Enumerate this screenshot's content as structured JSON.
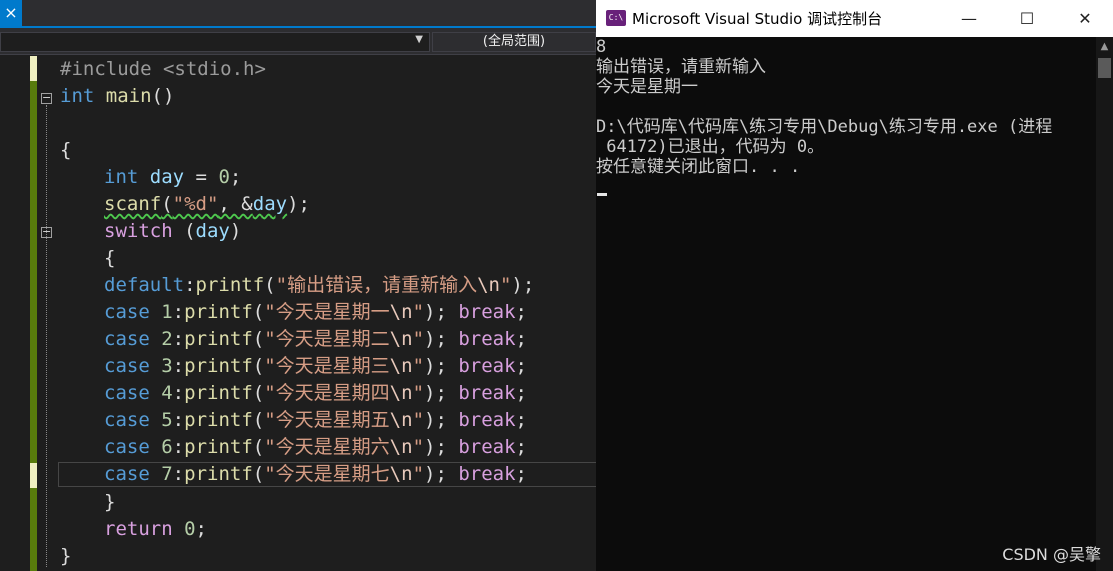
{
  "editor": {
    "tab_close_glyph": "×",
    "nav_scope": "(全局范围)",
    "code": {
      "l1_pp": "#include <stdio.h>",
      "l2_kw": "int",
      "l2_fn": "main",
      "l2_rest": "()",
      "l4": "{",
      "l5_kw": "int",
      "l5_var": "day",
      "l5_op": " = ",
      "l5_num": "0",
      "l5_end": ";",
      "l6_fn": "scanf",
      "l6_open": "(",
      "l6_str": "\"%d\"",
      "l6_sep": ", &",
      "l6_var": "day",
      "l6_end": ");",
      "l7_ctl": "switch",
      "l7_open": " (",
      "l7_var": "day",
      "l7_close": ")",
      "l8": "{",
      "l9_ctl": "default",
      "l9_colon": ":",
      "l9_fn": "printf",
      "l9_open": "(",
      "l9_str": "\"输出错误，请重新输入",
      "l9_esc": "\\n",
      "l9_q": "\"",
      "l9_end": ");",
      "cases": [
        {
          "kw": "case",
          "num": "1",
          "fn": "printf",
          "str": "\"今天是星期一",
          "esc": "\\n",
          "q": "\"",
          "brk": "break"
        },
        {
          "kw": "case",
          "num": "2",
          "fn": "printf",
          "str": "\"今天是星期二",
          "esc": "\\n",
          "q": "\"",
          "brk": "break"
        },
        {
          "kw": "case",
          "num": "3",
          "fn": "printf",
          "str": "\"今天是星期三",
          "esc": "\\n",
          "q": "\"",
          "brk": "break"
        },
        {
          "kw": "case",
          "num": "4",
          "fn": "printf",
          "str": "\"今天是星期四",
          "esc": "\\n",
          "q": "\"",
          "brk": "break"
        },
        {
          "kw": "case",
          "num": "5",
          "fn": "printf",
          "str": "\"今天是星期五",
          "esc": "\\n",
          "q": "\"",
          "brk": "break"
        },
        {
          "kw": "case",
          "num": "6",
          "fn": "printf",
          "str": "\"今天是星期六",
          "esc": "\\n",
          "q": "\"",
          "brk": "break"
        },
        {
          "kw": "case",
          "num": "7",
          "fn": "printf",
          "str": "\"今天是星期七",
          "esc": "\\n",
          "q": "\"",
          "brk": "break"
        }
      ],
      "l17": "}",
      "l18_ctl": "return",
      "l18_num": "0",
      "l18_end": ";",
      "l19": "}"
    }
  },
  "console": {
    "app_icon_text": "C:\\",
    "title": "Microsoft Visual Studio 调试控制台",
    "minimize_glyph": "—",
    "maximize_glyph": "☐",
    "close_glyph": "✕",
    "lines": [
      "8",
      "输出错误，请重新输入",
      "今天是星期一",
      "",
      "D:\\代码库\\代码库\\练习专用\\Debug\\练习专用.exe (进程",
      " 64172)已退出，代码为 0。",
      "按任意键关闭此窗口. . ."
    ],
    "scroll_up_glyph": "▲"
  },
  "watermark": "CSDN @吴擎"
}
